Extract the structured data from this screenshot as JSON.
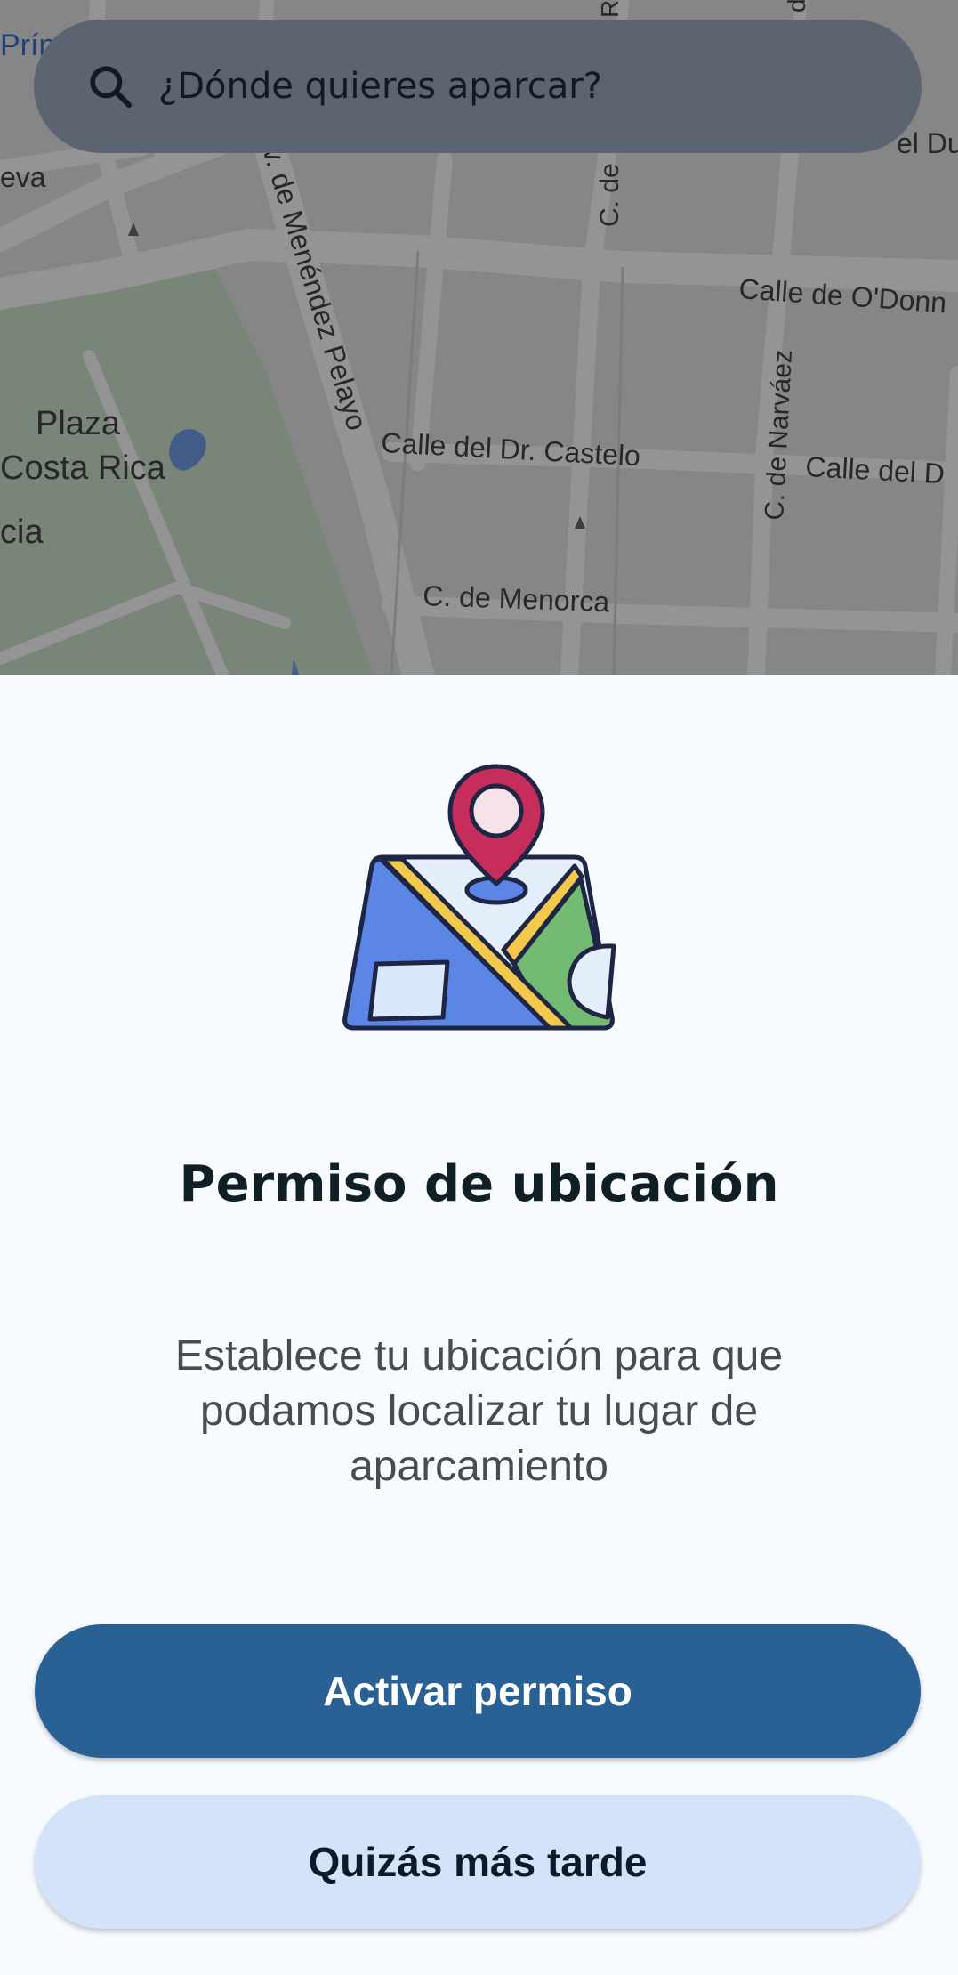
{
  "search": {
    "placeholder": "¿Dónde quieres aparcar?"
  },
  "map": {
    "labels": {
      "plaza": "Plaza",
      "costa_rica": "Costa Rica",
      "cia": "cia",
      "prin": "Prín",
      "eva": "eva",
      "av_menendez_pelayo": "v. de Menéndez Pelayo",
      "c_de_top": "C. de",
      "calle_odonnell": "Calle de O'Donn",
      "calle_dr_castelo": "Calle del Dr. Castelo",
      "c_narvaez": "C. de Narváez",
      "calle_del_d": "Calle del D",
      "c_menorca": "C. de Menorca",
      "el_du": "el Du",
      "top_c": "C",
      "top_ro": "Ro",
      "top_d": "d"
    }
  },
  "permission": {
    "title": "Permiso de ubicación",
    "description": "Establece tu ubicación para que podamos localizar tu lugar de aparcamiento",
    "primary_button": "Activar permiso",
    "secondary_button": "Quizás más tarde"
  },
  "colors": {
    "primary": "#2a6194",
    "secondary": "#d3e3fa",
    "pin": "#c72d5a",
    "map_blue": "#5b86e5",
    "map_yellow": "#f2c94c",
    "map_green": "#73bb73"
  },
  "icons": {
    "search": "search-icon",
    "illustration": "location-map-illustration"
  }
}
